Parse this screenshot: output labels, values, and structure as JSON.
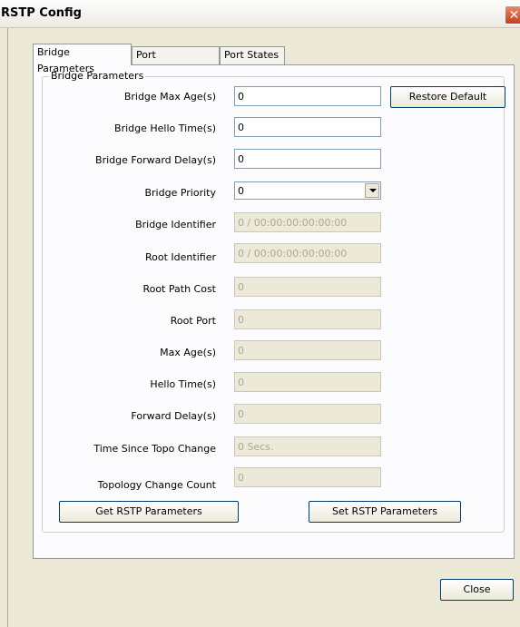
{
  "window": {
    "title": "RSTP Config"
  },
  "tabs": [
    "Bridge Parameters",
    "Port Parameters",
    "Port States"
  ],
  "group": {
    "title": "Bridge Parameters"
  },
  "buttons": {
    "restore_default": "Restore Default",
    "get_rstp": "Get RSTP Parameters",
    "set_rstp": "Set RSTP Parameters",
    "close": "Close"
  },
  "fields": [
    {
      "label": "Bridge Max Age(s)",
      "value": "0",
      "editable": true
    },
    {
      "label": "Bridge Hello Time(s)",
      "value": "0",
      "editable": true
    },
    {
      "label": "Bridge Forward Delay(s)",
      "value": "0",
      "editable": true
    },
    {
      "label": "Bridge Priority",
      "value": "0",
      "editable": true,
      "type": "select"
    },
    {
      "label": "Bridge Identifier",
      "value": "0 / 00:00:00:00:00:00",
      "editable": false
    },
    {
      "label": "Root Identifier",
      "value": "0 / 00:00:00:00:00:00",
      "editable": false
    },
    {
      "label": "Root Path Cost",
      "value": "0",
      "editable": false
    },
    {
      "label": "Root Port",
      "value": "0",
      "editable": false
    },
    {
      "label": "Max Age(s)",
      "value": "0",
      "editable": false
    },
    {
      "label": "Hello Time(s)",
      "value": "0",
      "editable": false
    },
    {
      "label": "Forward Delay(s)",
      "value": "0",
      "editable": false
    },
    {
      "label": "Time Since Topo Change",
      "value": "0 Secs.",
      "editable": false
    },
    {
      "label": "Topology Change Count",
      "value": "0",
      "editable": false
    }
  ]
}
